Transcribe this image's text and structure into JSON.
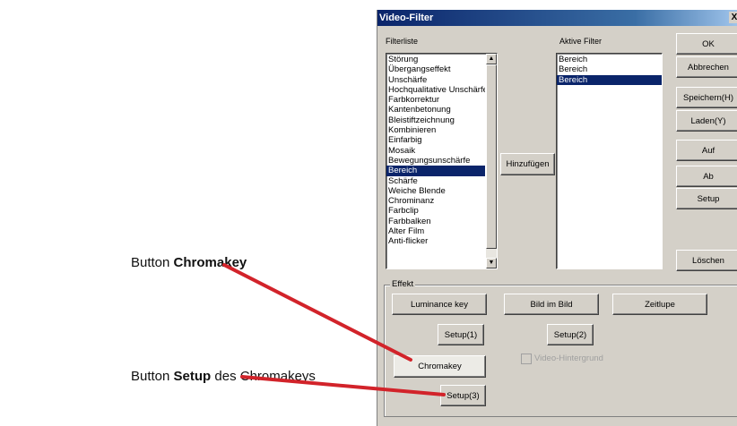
{
  "annotations": {
    "chromakey": {
      "prefix": "Button ",
      "bold": "Chromakey",
      "suffix": ""
    },
    "setup": {
      "prefix": "Button ",
      "bold": "Setup",
      "suffix": " des Chromakeys"
    },
    "arrow_color": "#d2232a"
  },
  "dialog": {
    "title": "Video-Filter",
    "close_label": "X",
    "filterliste_label": "Filterliste",
    "aktive_label": "Aktive Filter",
    "filter_list": [
      "Störung",
      "Übergangseffekt",
      "Unschärfe",
      "Hochqualitative Unschärfe",
      "Farbkorrektur",
      "Kantenbetonung",
      "Bleistiftzeichnung",
      "Kombinieren",
      "Einfarbig",
      "Mosaik",
      "Bewegungsunschärfe",
      "Bereich",
      "Schärfe",
      "Weiche Blende",
      "Chrominanz",
      "Farbclip",
      "Farbbalken",
      "Alter Film",
      "Anti-flicker"
    ],
    "filter_selected_index": 11,
    "active_list": [
      "Bereich",
      "Bereich",
      "Bereich"
    ],
    "active_selected_index": 2,
    "buttons": {
      "ok": "OK",
      "abbrechen": "Abbrechen",
      "speichern": "Speichern(H)",
      "laden": "Laden(Y)",
      "auf": "Auf",
      "ab": "Ab",
      "setup": "Setup",
      "loeschen": "Löschen",
      "hinzufuegen": "Hinzufügen"
    },
    "effekt": {
      "label": "Effekt",
      "luminance": "Luminance key",
      "bild": "Bild im Bild",
      "zeitlupe": "Zeitlupe",
      "setup1": "Setup(1)",
      "setup2": "Setup(2)",
      "chromakey": "Chromakey",
      "video_hintergrund": "Video-Hintergrund",
      "setup3": "Setup(3)"
    }
  }
}
